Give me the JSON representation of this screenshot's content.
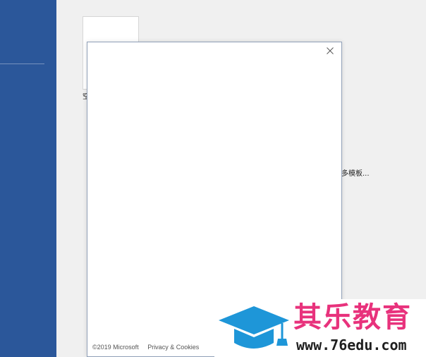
{
  "backstage": {
    "template_caption": "空",
    "more_templates_label": "多模板..."
  },
  "dialog": {
    "close_icon": "close-icon",
    "footer": {
      "copyright": "©2019 Microsoft",
      "privacy_link": "Privacy & Cookies"
    }
  },
  "watermark": {
    "brand_name": "其乐教育",
    "url": "www.76edu.com"
  },
  "colors": {
    "sidebar_blue": "#2b579a",
    "watermark_pink": "#e8327c",
    "watermark_cap_blue": "#1e96d8"
  }
}
